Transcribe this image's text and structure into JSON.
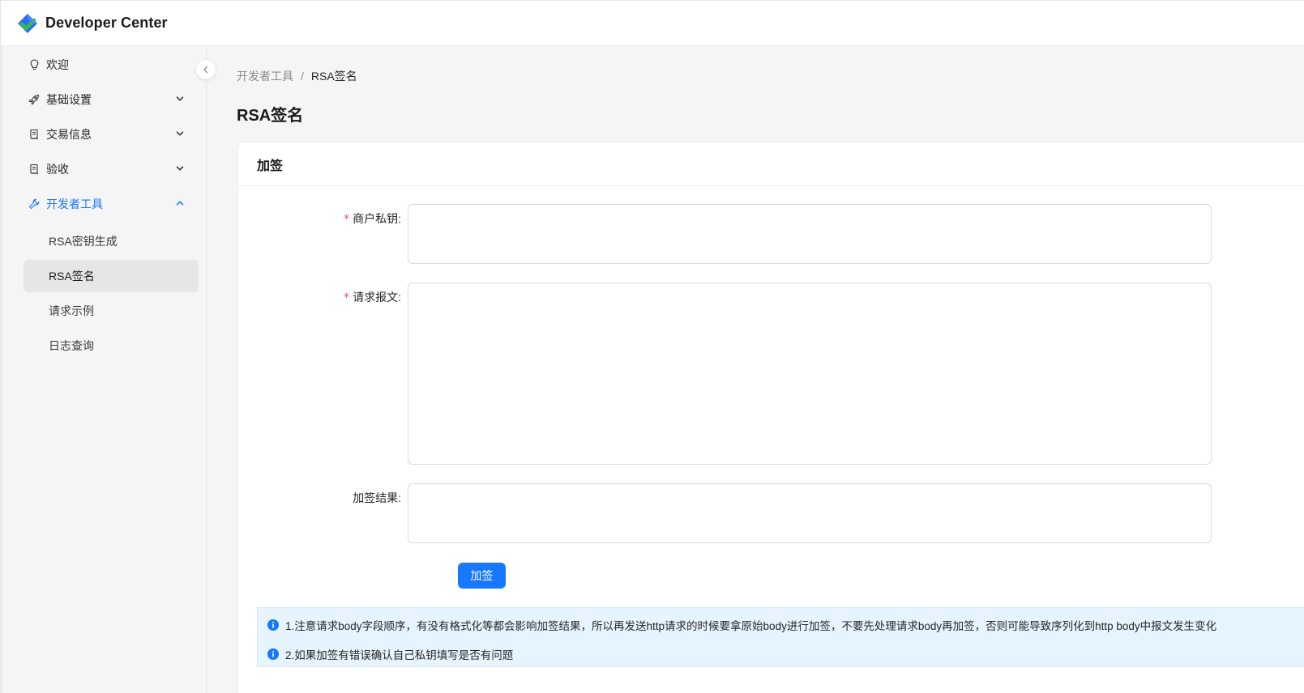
{
  "app": {
    "title": "Developer Center",
    "colors": {
      "accent": "#1677ff",
      "logo_blue": "#2a6cf6",
      "logo_green": "#2fbf4a"
    }
  },
  "sidebar": {
    "items": [
      {
        "label": "欢迎",
        "icon": "lightbulb-icon"
      },
      {
        "label": "基础设置",
        "icon": "rocket-icon",
        "expandable": true
      },
      {
        "label": "交易信息",
        "icon": "receipt-icon",
        "expandable": true
      },
      {
        "label": "验收",
        "icon": "receipt-icon",
        "expandable": true
      },
      {
        "label": "开发者工具",
        "icon": "wrench-icon",
        "expandable": true,
        "expanded": true,
        "active": true
      }
    ],
    "subitems": [
      {
        "label": "RSA密钥生成"
      },
      {
        "label": "RSA签名",
        "selected": true
      },
      {
        "label": "请求示例"
      },
      {
        "label": "日志查询"
      }
    ]
  },
  "breadcrumb": {
    "parent": "开发者工具",
    "separator": "/",
    "current": "RSA签名"
  },
  "page": {
    "title": "RSA签名"
  },
  "card": {
    "title": "加签"
  },
  "form": {
    "private_key": {
      "label": "商户私钥:",
      "required": true,
      "value": ""
    },
    "request_body": {
      "label": "请求报文:",
      "required": true,
      "value": ""
    },
    "result": {
      "label": "加签结果:",
      "required": false,
      "value": ""
    },
    "submit_label": "加签"
  },
  "notice": {
    "lines": [
      "1.注意请求body字段顺序，有没有格式化等都会影响加签结果，所以再发送http请求的时候要拿原始body进行加签，不要先处理请求body再加签，否则可能导致序列化到http body中报文发生变化",
      "2.如果加签有错误确认自己私钥填写是否有问题"
    ]
  }
}
